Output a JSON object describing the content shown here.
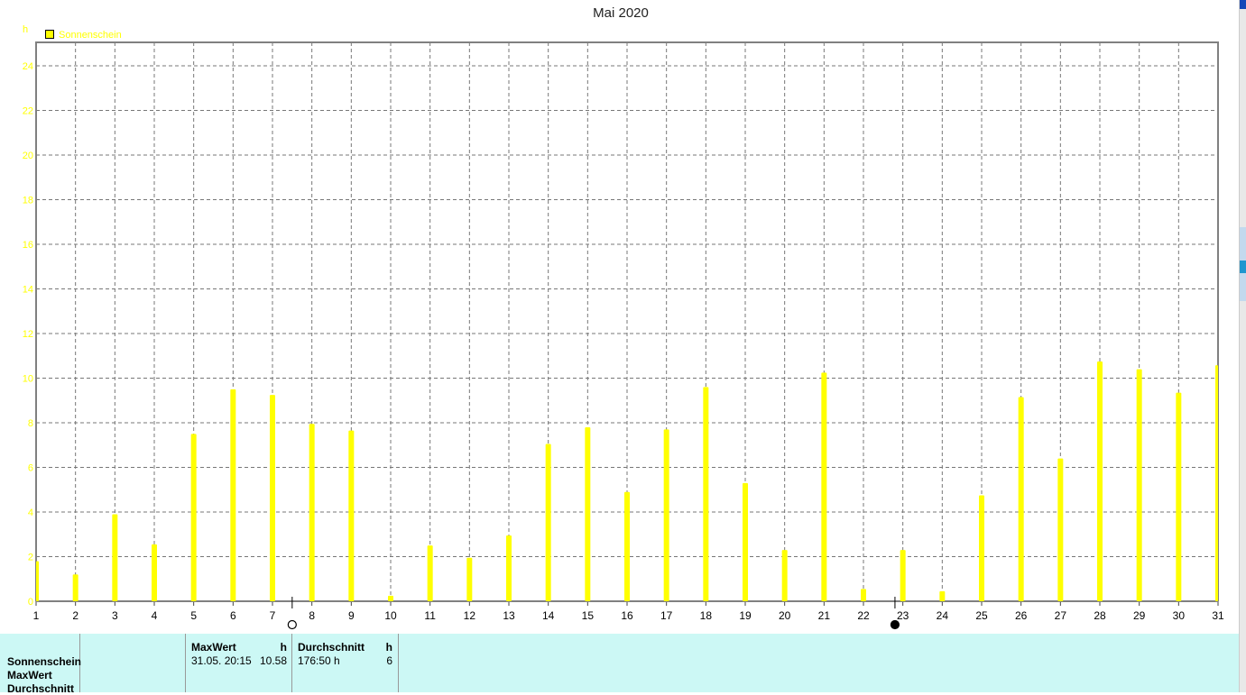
{
  "chart_data": {
    "type": "bar",
    "title": "Mai 2020",
    "ylabel": "h",
    "xlabel": "",
    "ylim": [
      0,
      24.8
    ],
    "yticks": [
      "0",
      "2",
      "4",
      "6",
      "8",
      "10",
      "12",
      "14",
      "16",
      "18",
      "20",
      "22",
      "24"
    ],
    "grid": true,
    "legend": {
      "position": "top-left",
      "entries": [
        "Sonnenschein"
      ]
    },
    "categories": [
      "1",
      "2",
      "3",
      "4",
      "5",
      "6",
      "7",
      "8",
      "9",
      "10",
      "11",
      "12",
      "13",
      "14",
      "15",
      "16",
      "17",
      "18",
      "19",
      "20",
      "21",
      "22",
      "23",
      "24",
      "25",
      "26",
      "27",
      "28",
      "29",
      "30",
      "31"
    ],
    "series": [
      {
        "name": "Sonnenschein",
        "color": "#ffff00",
        "values": [
          1.8,
          1.2,
          3.9,
          2.55,
          7.5,
          9.5,
          9.25,
          7.95,
          7.65,
          0.25,
          2.5,
          1.95,
          2.95,
          7.05,
          7.8,
          4.9,
          7.7,
          9.6,
          5.3,
          2.3,
          10.25,
          0.55,
          2.3,
          0.45,
          4.75,
          9.15,
          6.4,
          10.75,
          10.4,
          9.35,
          10.58
        ]
      }
    ],
    "moon_phases": [
      {
        "day": 7.5,
        "phase": "full"
      },
      {
        "day": 22.8,
        "phase": "new"
      }
    ]
  },
  "table": {
    "row_labels": [
      "Sonnenschein",
      "MaxWert",
      "Durchschnitt"
    ],
    "max_header": "MaxWert",
    "max_unit": "h",
    "max_date": "31.05.  20:15",
    "max_value": "10.58",
    "avg_header": "Durchschnitt",
    "avg_unit": "h",
    "avg_total": "176:50 h",
    "avg_value": "6"
  }
}
